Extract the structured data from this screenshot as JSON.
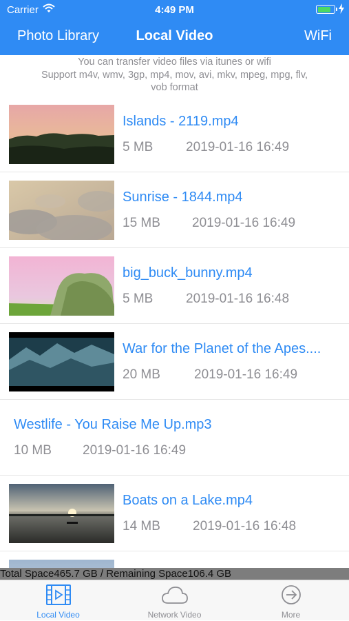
{
  "status_bar": {
    "carrier": "Carrier",
    "time": "4:49 PM",
    "battery_level": 0.85
  },
  "nav": {
    "left": "Photo Library",
    "title": "Local Video",
    "right": "WiFi"
  },
  "info": {
    "line1": "You can transfer video files via itunes or wifi",
    "line2": "Support m4v, wmv, 3gp, mp4, mov, avi, mkv, mpeg, mpg, flv,",
    "line3": "vob format"
  },
  "files": [
    {
      "name": "Islands - 2119.mp4",
      "size": "5 MB",
      "date": "2019-01-16 16:49",
      "thumbnail": "sunset-hills"
    },
    {
      "name": "Sunrise - 1844.mp4",
      "size": "15 MB",
      "date": "2019-01-16 16:49",
      "thumbnail": "cloudy-sky"
    },
    {
      "name": "big_buck_bunny.mp4",
      "size": "5 MB",
      "date": "2019-01-16 16:48",
      "thumbnail": "meadow-tree"
    },
    {
      "name": "War for the Planet of the Apes....",
      "size": "20 MB",
      "date": "2019-01-16 16:49",
      "thumbnail": "snowy-mountains"
    },
    {
      "name": "Westlife - You Raise Me Up.mp3",
      "size": "10 MB",
      "date": "2019-01-16 16:49",
      "thumbnail": ""
    },
    {
      "name": "Boats on a Lake.mp4",
      "size": "14 MB",
      "date": "2019-01-16 16:48",
      "thumbnail": "lake-sunset"
    },
    {
      "name": "",
      "size": "",
      "date": "",
      "thumbnail": "partial-sky"
    }
  ],
  "storage": {
    "text": "Total Space465.7 GB / Remaining Space106.4 GB"
  },
  "tabs": [
    {
      "label": "Local Video",
      "icon": "film-icon",
      "active": true
    },
    {
      "label": "Network Video",
      "icon": "cloud-icon",
      "active": false
    },
    {
      "label": "More",
      "icon": "arrow-circle-icon",
      "active": false
    }
  ],
  "colors": {
    "accent": "#2f8bf4",
    "secondary_text": "#8e8e93",
    "inactive_tab": "#8e8e93"
  }
}
